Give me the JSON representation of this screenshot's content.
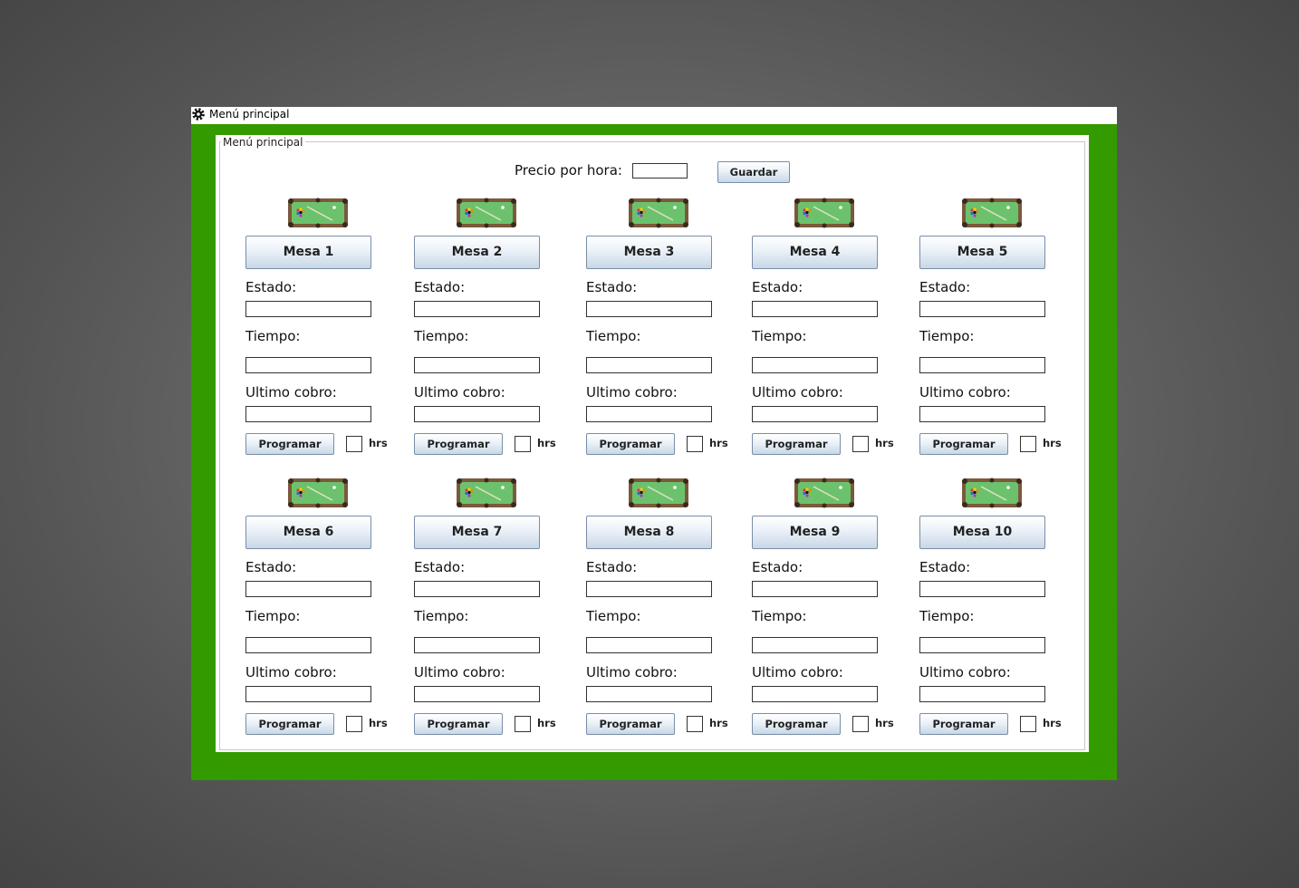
{
  "window": {
    "title": "Menú principal",
    "icon": "gear-icon"
  },
  "panel": {
    "group_title": "Menú principal"
  },
  "price": {
    "label": "Precio por hora:",
    "value": "",
    "save_label": "Guardar"
  },
  "tables": [
    {
      "name": "Mesa 1",
      "estado_label": "Estado:",
      "tiempo_label": "Tiempo:",
      "cobro_label": "Ultimo cobro:",
      "program_label": "Programar",
      "hrs_label": "hrs"
    },
    {
      "name": "Mesa 2",
      "estado_label": "Estado:",
      "tiempo_label": "Tiempo:",
      "cobro_label": "Ultimo cobro:",
      "program_label": "Programar",
      "hrs_label": "hrs"
    },
    {
      "name": "Mesa 3",
      "estado_label": "Estado:",
      "tiempo_label": "Tiempo:",
      "cobro_label": "Ultimo cobro:",
      "program_label": "Programar",
      "hrs_label": "hrs"
    },
    {
      "name": "Mesa 4",
      "estado_label": "Estado:",
      "tiempo_label": "Tiempo:",
      "cobro_label": "Ultimo cobro:",
      "program_label": "Programar",
      "hrs_label": "hrs"
    },
    {
      "name": "Mesa 5",
      "estado_label": "Estado:",
      "tiempo_label": "Tiempo:",
      "cobro_label": "Ultimo cobro:",
      "program_label": "Programar",
      "hrs_label": "hrs"
    },
    {
      "name": "Mesa 6",
      "estado_label": "Estado:",
      "tiempo_label": "Tiempo:",
      "cobro_label": "Ultimo cobro:",
      "program_label": "Programar",
      "hrs_label": "hrs"
    },
    {
      "name": "Mesa 7",
      "estado_label": "Estado:",
      "tiempo_label": "Tiempo:",
      "cobro_label": "Ultimo cobro:",
      "program_label": "Programar",
      "hrs_label": "hrs"
    },
    {
      "name": "Mesa 8",
      "estado_label": "Estado:",
      "tiempo_label": "Tiempo:",
      "cobro_label": "Ultimo cobro:",
      "program_label": "Programar",
      "hrs_label": "hrs"
    },
    {
      "name": "Mesa 9",
      "estado_label": "Estado:",
      "tiempo_label": "Tiempo:",
      "cobro_label": "Ultimo cobro:",
      "program_label": "Programar",
      "hrs_label": "hrs"
    },
    {
      "name": "Mesa 10",
      "estado_label": "Estado:",
      "tiempo_label": "Tiempo:",
      "cobro_label": "Ultimo cobro:",
      "program_label": "Programar",
      "hrs_label": "hrs"
    }
  ],
  "colors": {
    "frame_green": "#339a00",
    "felt_green": "#6cc26c",
    "rail_brown": "#7a5a3c"
  }
}
